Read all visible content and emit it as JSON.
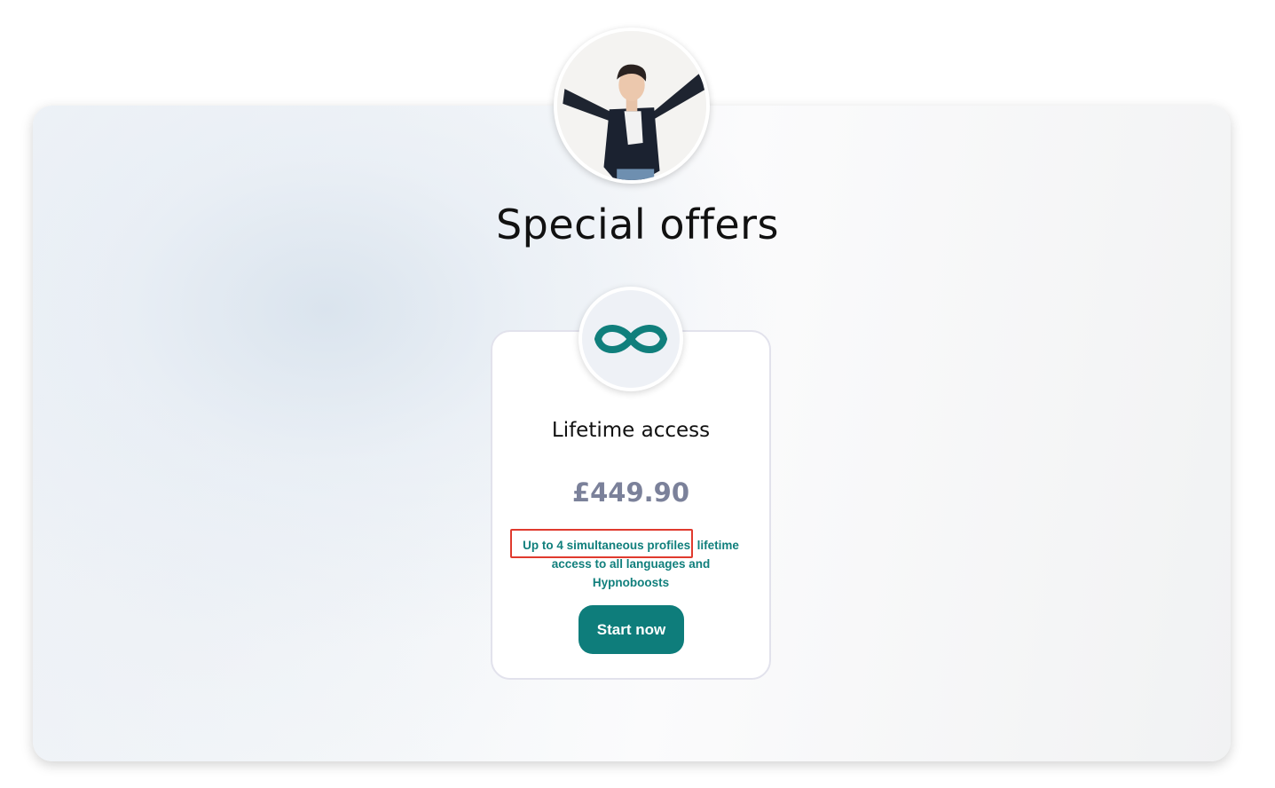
{
  "header": {
    "title": "Special offers",
    "avatar_icon": "person-jumping-photo"
  },
  "offer": {
    "icon": "infinity-icon",
    "title": "Lifetime access",
    "price": "£449.90",
    "description_highlight": "Up to 4 simultaneous profiles",
    "description_rest": ", lifetime access to all languages and Hypnoboosts",
    "button_label": "Start now"
  },
  "colors": {
    "accent": "#0e7d7b",
    "price": "#7b819a",
    "highlight_border": "#e03a2e"
  }
}
